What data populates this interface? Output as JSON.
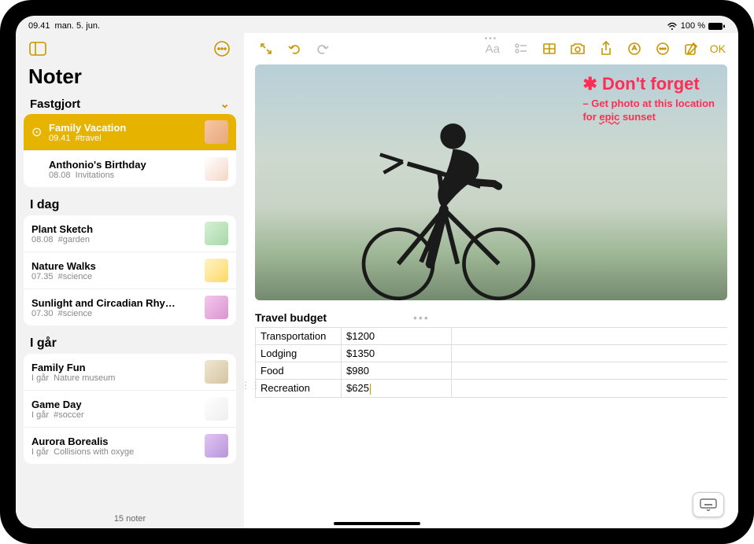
{
  "status": {
    "time": "09.41",
    "date": "man. 5. jun.",
    "battery": "100 %"
  },
  "sidebar": {
    "title": "Noter",
    "sections": [
      {
        "label": "Fastgjort",
        "notes": [
          {
            "title": "Family Vacation",
            "time": "09.41",
            "tag": "#travel",
            "selected": true,
            "pinned": true
          },
          {
            "title": "Anthonio's Birthday",
            "time": "08.08",
            "tag": "Invitations"
          }
        ]
      },
      {
        "label": "I dag",
        "notes": [
          {
            "title": "Plant Sketch",
            "time": "08.08",
            "tag": "#garden"
          },
          {
            "title": "Nature Walks",
            "time": "07.35",
            "tag": "#science"
          },
          {
            "title": "Sunlight and Circadian Rhy…",
            "time": "07.30",
            "tag": "#science"
          }
        ]
      },
      {
        "label": "I går",
        "notes": [
          {
            "title": "Family Fun",
            "time": "I går",
            "tag": "Nature museum"
          },
          {
            "title": "Game Day",
            "time": "I går",
            "tag": "#soccer"
          },
          {
            "title": "Aurora Borealis",
            "time": "I går",
            "tag": "Collisions with oxyge"
          }
        ]
      }
    ],
    "footer": "15 noter"
  },
  "toolbar": {
    "ok": "OK"
  },
  "handwriting": {
    "line1": "✱ Don't forget",
    "line2a": "– Get photo at this location",
    "line2b_pre": "for ",
    "line2b_u": "epic",
    "line2b_post": " sunset"
  },
  "budget": {
    "title": "Travel budget",
    "rows": [
      {
        "label": "Transportation",
        "value": "$1200"
      },
      {
        "label": "Lodging",
        "value": "$1350"
      },
      {
        "label": "Food",
        "value": "$980"
      },
      {
        "label": "Recreation",
        "value": "$625"
      }
    ]
  }
}
